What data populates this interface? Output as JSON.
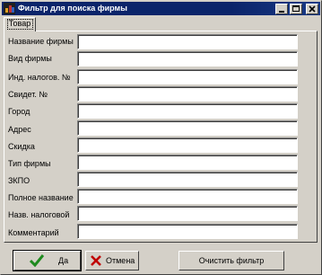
{
  "window": {
    "title": "Фильтр для поиска фирмы",
    "controls": {
      "minimize": "_",
      "maximize": "□",
      "close": "x"
    }
  },
  "tabs": [
    {
      "label": "Товар"
    }
  ],
  "fields": [
    {
      "label": "Название фирмы",
      "value": ""
    },
    {
      "label": "Вид фирмы",
      "value": ""
    },
    {
      "label": "Инд. налогов. №",
      "value": ""
    },
    {
      "label": "Свидет. №",
      "value": ""
    },
    {
      "label": "Город",
      "value": ""
    },
    {
      "label": "Адрес",
      "value": ""
    },
    {
      "label": "Скидка",
      "value": ""
    },
    {
      "label": "Тип фирмы",
      "value": ""
    },
    {
      "label": "ЗКПО",
      "value": ""
    },
    {
      "label": "Полное название",
      "value": ""
    },
    {
      "label": "Назв. налоговой",
      "value": ""
    },
    {
      "label": "Комментарий",
      "value": ""
    }
  ],
  "buttons": {
    "ok": "Да",
    "cancel": "Отмена",
    "clear": "Очистить фильтр"
  },
  "colors": {
    "titlebar": "#0a246a",
    "face": "#d4d0c8",
    "ok_check": "#1e8a1e",
    "cancel_x": "#c00000"
  }
}
